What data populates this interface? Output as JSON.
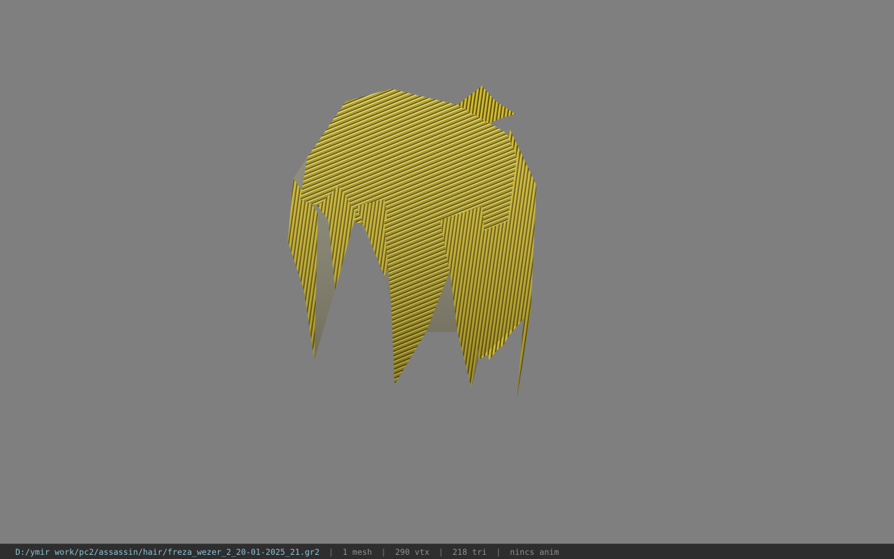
{
  "viewer": {
    "background_color": "#7f7f7f",
    "model_icon": "hair-mesh-icon"
  },
  "statusbar": {
    "file_path": "D:/ymir work/pc2/assassin/hair/freza_wezer_2_20-01-2025_21.gr2",
    "separator": "|",
    "mesh_count": "1 mesh",
    "vertex_count": "290 vtx",
    "triangle_count": "218 tri",
    "anim_status": "nincs anim"
  }
}
